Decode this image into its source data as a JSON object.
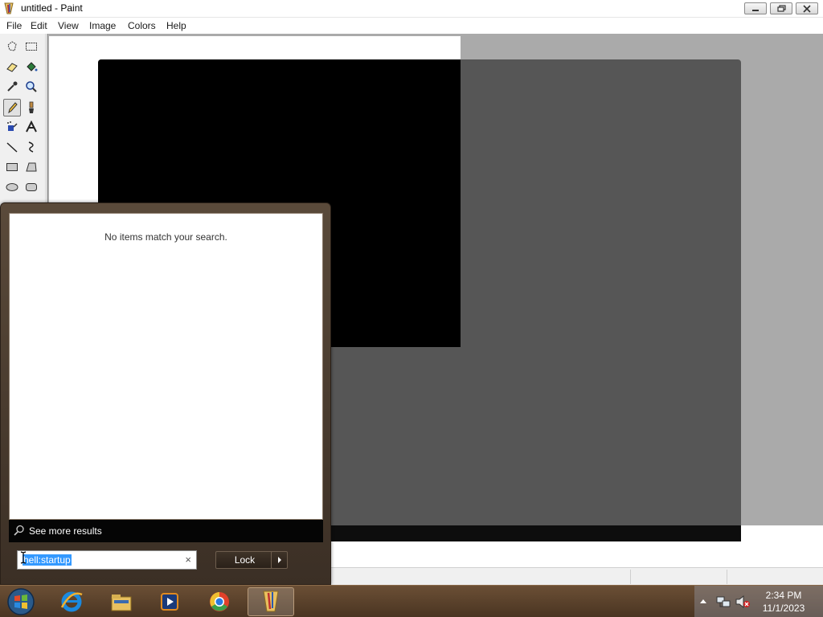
{
  "window": {
    "title": "untitled - Paint"
  },
  "menu": {
    "items": [
      "File",
      "Edit",
      "View",
      "Image",
      "Colors",
      "Help"
    ]
  },
  "tools": {
    "icons": [
      "free-form-select-icon",
      "rectangle-select-icon",
      "eraser-icon",
      "fill-bucket-icon",
      "color-picker-icon",
      "magnifier-icon",
      "pencil-icon",
      "brush-icon",
      "airbrush-icon",
      "text-icon",
      "line-icon",
      "curve-icon",
      "rectangle-icon",
      "polygon-icon",
      "ellipse-icon",
      "rounded-rectangle-icon"
    ],
    "selected": "pencil-icon"
  },
  "canvas": {
    "colors": {
      "workspace": "#aaaaaa",
      "sheet": "#ffffff",
      "shape_black": "#000000",
      "shape_gray": "#565656"
    }
  },
  "start_menu": {
    "no_results_text": "No items match your search.",
    "see_more_label": "See more results",
    "search_value": "hell:startup",
    "clear_symbol": "×",
    "lock_label": "Lock"
  },
  "taskbar": {
    "apps": [
      "internet-explorer-icon",
      "file-explorer-icon",
      "media-player-icon",
      "chrome-icon",
      "paint-icon"
    ],
    "active_app": "paint-icon",
    "clock": {
      "time": "2:34 PM",
      "date": "11/1/2023"
    }
  }
}
